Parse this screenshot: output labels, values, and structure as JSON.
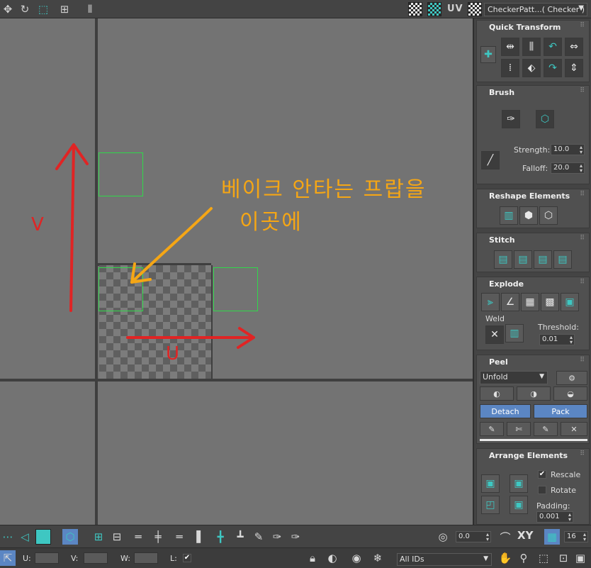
{
  "colors": {
    "accent_teal": "#3ec7c2",
    "uv_box_green": "#30d84a",
    "annotation_orange": "#f5a615",
    "arrow_red": "#e02424",
    "button_blue": "#5b86c3"
  },
  "toolbar": {
    "uv_label": "UV",
    "texture_select": "CheckerPatt...( Checker )"
  },
  "annotations": {
    "line1": "베이크 안타는 프랍을",
    "line2": "이곳에",
    "u_label": "U",
    "v_label": "V"
  },
  "panel": {
    "quick_transform": {
      "title": "Quick Transform"
    },
    "brush": {
      "title": "Brush",
      "strength_label": "Strength:",
      "strength_value": "10.0",
      "falloff_label": "Falloff:",
      "falloff_value": "20.0"
    },
    "reshape": {
      "title": "Reshape Elements"
    },
    "stitch": {
      "title": "Stitch"
    },
    "explode": {
      "title": "Explode",
      "weld_label": "Weld",
      "threshold_label": "Threshold:",
      "threshold_value": "0.01"
    },
    "peel": {
      "title": "Peel",
      "mode": "Unfold",
      "detach_label": "Detach",
      "pack_label": "Pack"
    },
    "arrange": {
      "title": "Arrange Elements",
      "rescale_label": "Rescale",
      "rescale_checked": true,
      "rotate_label": "Rotate",
      "rotate_checked": false,
      "padding_label": "Padding:",
      "padding_value": "0.001"
    }
  },
  "bottom": {
    "angle_value": "0.0",
    "xy_label": "XY",
    "grid_value": "16",
    "u_label": "U:",
    "v_label": "V:",
    "w_label": "W:",
    "l_label": "L:",
    "id_filter": "All IDs"
  }
}
